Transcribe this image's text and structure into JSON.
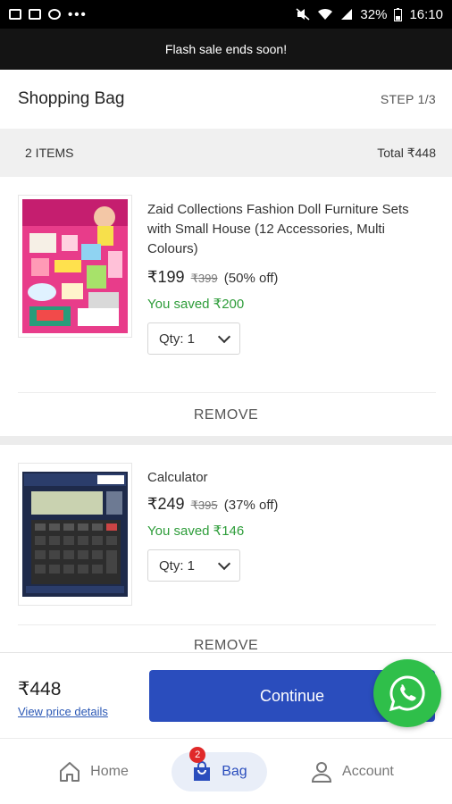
{
  "status_bar": {
    "battery": "32%",
    "time": "16:10",
    "dots": "•••"
  },
  "flash_banner": {
    "text": "Flash sale ends soon!"
  },
  "header": {
    "title": "Shopping Bag",
    "step": "STEP 1/3"
  },
  "summary": {
    "items": "2 ITEMS",
    "total": "Total ₹448"
  },
  "items": [
    {
      "name": "Zaid Collections Fashion Doll Furniture Sets with Small House (12 Accessories, Multi Colours)",
      "price": "₹199",
      "old_price": "₹399",
      "discount": "(50% off)",
      "saved": "You saved ₹200",
      "qty": "Qty: 1",
      "remove": "REMOVE"
    },
    {
      "name": "Calculator",
      "price": "₹249",
      "old_price": "₹395",
      "discount": "(37% off)",
      "saved": "You saved ₹146",
      "qty": "Qty: 1",
      "remove": "REMOVE"
    }
  ],
  "checkout": {
    "total": "₹448",
    "details_link": "View price details",
    "continue_label": "Continue"
  },
  "bottom_nav": {
    "home": "Home",
    "bag": "Bag",
    "bag_badge": "2",
    "account": "Account"
  },
  "colors": {
    "accent": "#2a4dbd",
    "saved_green": "#2e9d3a",
    "whatsapp": "#2fbf4a",
    "badge": "#e02929"
  }
}
